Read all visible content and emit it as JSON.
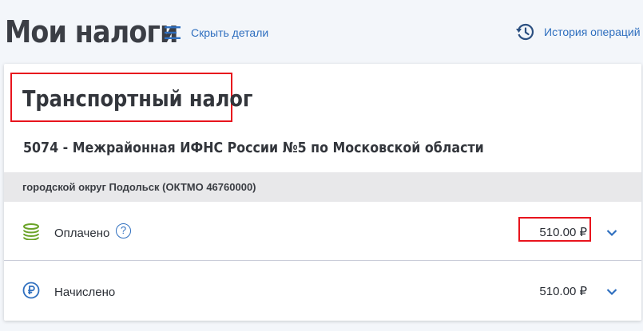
{
  "header": {
    "title": "Мои налоги",
    "hide_details_label": "Скрыть детали",
    "history_label": "История операций"
  },
  "card": {
    "tax_name": "Транспортный налог",
    "inspection": "5074 - Межрайонная ИФНС России №5 по Московской области",
    "municipality": "городской округ Подольск (ОКТМО 46760000)",
    "rows": [
      {
        "label": "Оплачено",
        "amount": "510.00 ₽",
        "icon": "coins-icon",
        "help": "?"
      },
      {
        "label": "Начислено",
        "amount": "510.00 ₽",
        "icon": "ruble-icon"
      }
    ]
  },
  "colors": {
    "accent_blue": "#2f6fbf",
    "highlight_red": "#e8141d",
    "coins_green": "#6aa327",
    "band_gray": "#e8e8ea"
  }
}
